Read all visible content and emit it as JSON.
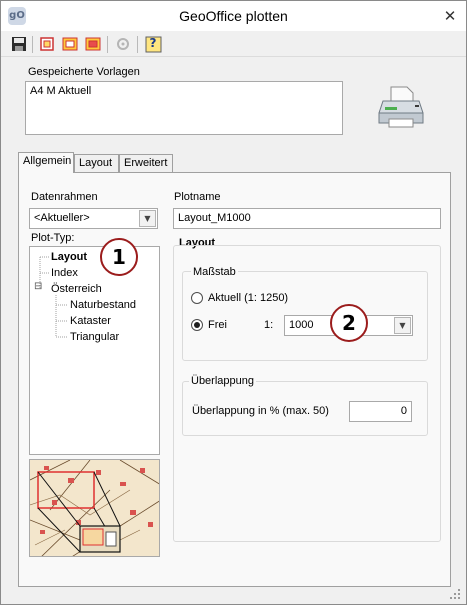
{
  "window": {
    "title": "GeoOffice plotten",
    "app_icon": "gO",
    "close_glyph": "✕"
  },
  "toolbar": {
    "items": [
      {
        "icon": "save-icon"
      },
      {
        "icon": "select-extent-icon"
      },
      {
        "icon": "layout-open-icon"
      },
      {
        "icon": "layout-delete-icon"
      },
      {
        "icon": "settings-disabled-icon"
      },
      {
        "icon": "help-icon",
        "glyph": "?"
      }
    ]
  },
  "templates": {
    "label": "Gespeicherte Vorlagen",
    "items": [
      "A4 M Aktuell"
    ]
  },
  "tabs": [
    {
      "label": "Allgemein",
      "active": true
    },
    {
      "label": "Layout",
      "active": false
    },
    {
      "label": "Erweitert",
      "active": false
    }
  ],
  "general": {
    "datenrahmen_label": "Datenrahmen",
    "datenrahmen_value": "<Aktueller>",
    "plottyp_label": "Plot-Typ:",
    "tree": [
      {
        "label": "Layout",
        "bold": true,
        "level": 0
      },
      {
        "label": "Index",
        "bold": false,
        "level": 0
      },
      {
        "label": "Österreich",
        "bold": false,
        "level": 0,
        "expander": "⊟"
      },
      {
        "label": "Naturbestand",
        "bold": false,
        "level": 1
      },
      {
        "label": "Kataster",
        "bold": false,
        "level": 1
      },
      {
        "label": "Triangular",
        "bold": false,
        "level": 1
      }
    ],
    "plotname_label": "Plotname",
    "plotname_value": "Layout_M1000",
    "layout_group_title": "Layout",
    "massstab": {
      "title": "Maßstab",
      "option_current": "Aktuell (1: 1250)",
      "option_free": "Frei",
      "selected": "free",
      "ratio_prefix": "1:",
      "scale_value": "1000"
    },
    "overlap": {
      "title": "Überlappung",
      "label": "Überlappung in % (max. 50)",
      "value": "0"
    }
  },
  "callouts": [
    "1",
    "2"
  ],
  "colors": {
    "callout_border": "#9b1c1c",
    "panel_bg": "#f9f9f9",
    "window_bg": "#f0f0f0"
  }
}
